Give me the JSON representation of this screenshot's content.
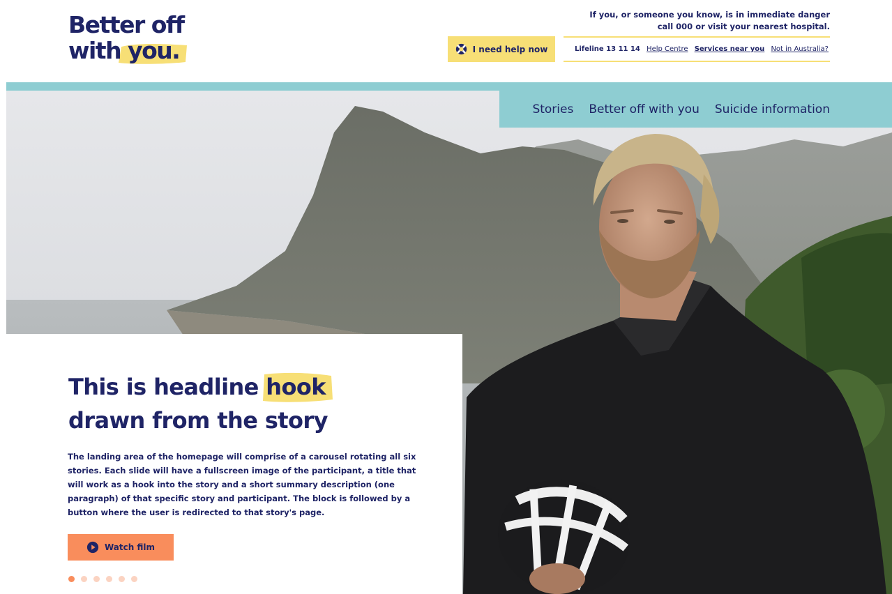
{
  "brand": {
    "logo_line1": "Better off",
    "logo_line2_a": "with ",
    "logo_line2_b": "you."
  },
  "header": {
    "danger_line1": "If you, or someone you know, is in immediate danger",
    "danger_line2": "call 000 or visit your nearest hospital.",
    "help_button": "I need help now",
    "utility": {
      "lifeline": "Lifeline 13 11 14",
      "help_centre": "Help Centre",
      "services": "Services near you",
      "not_australia": "Not in Australia?"
    }
  },
  "nav": {
    "items": [
      "Stories",
      "Better off with you",
      "Suicide information"
    ]
  },
  "hero": {
    "headline_part1": "This is headline ",
    "headline_highlight": "hook",
    "headline_part2": "drawn from the story",
    "summary": "The landing area of the homepage will comprise of a carousel rotating all six stories. Each slide will have a fullscreen image of the participant, a title that will work as a hook into the story and a short summary description (one paragraph) of that specific story and participant. The block is followed by a button where the user is redirected to that story's page.",
    "cta": "Watch film",
    "carousel": {
      "total": 6,
      "active": 1
    }
  },
  "colors": {
    "navy": "#1f2466",
    "yellow": "#f7df76",
    "teal": "#8ecdd2",
    "orange": "#f98d5c"
  },
  "icons": {
    "help": "lifebuoy-icon",
    "cta": "play-icon"
  }
}
